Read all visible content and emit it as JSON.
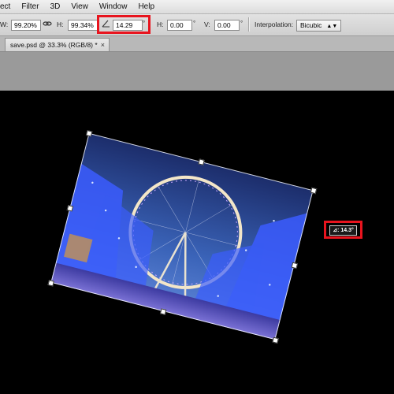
{
  "menubar": {
    "items": [
      "ect",
      "Filter",
      "3D",
      "View",
      "Window",
      "Help"
    ]
  },
  "options": {
    "w_label": "W:",
    "w_value": "99.20%",
    "link_icon": "chain-link-icon",
    "h_label": "H:",
    "h_value": "99.34%",
    "angle_icon": "angle-icon",
    "angle_value": "14.29",
    "angle_unit": "°",
    "hskew_label": "H:",
    "hskew_value": "0.00",
    "hskew_unit": "°",
    "vskew_label": "V:",
    "vskew_value": "0.00",
    "vskew_unit": "°",
    "interp_label": "Interpolation:",
    "interp_value": "Bicubic"
  },
  "tab": {
    "title": "save.psd @ 33.3% (RGB/8) *",
    "close": "×"
  },
  "readout": {
    "text": "⊿: 14.3°"
  },
  "colors": {
    "highlight": "#e8141e",
    "sky_top": "#1c2d6b",
    "lights": "#3b5cff"
  },
  "image": {
    "rotation_degrees": 14.3
  }
}
